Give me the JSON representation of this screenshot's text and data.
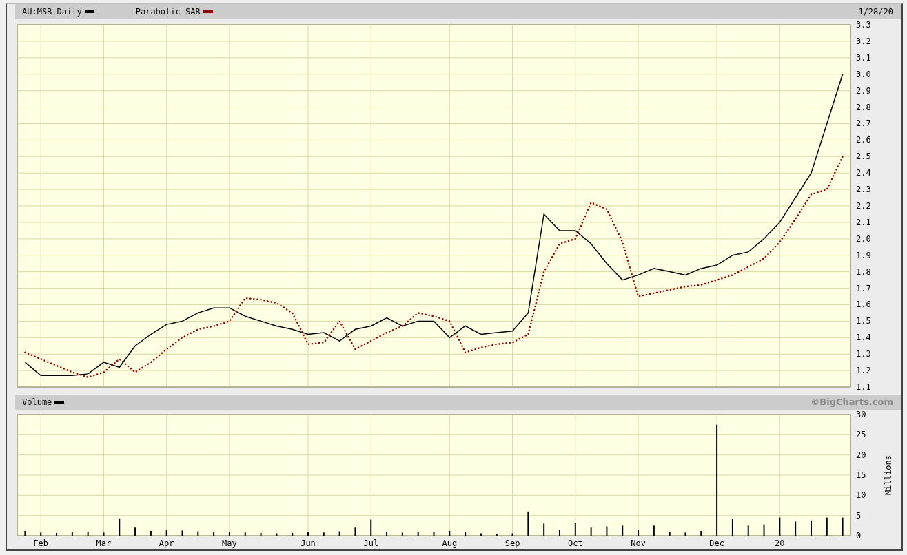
{
  "header": {
    "date": "1/28/20"
  },
  "price_chart": {
    "chart_data": {
      "type": "line",
      "grid": true,
      "categories": [
        null,
        null,
        null,
        null,
        null,
        null,
        null,
        null,
        null,
        null,
        null,
        null,
        null,
        null,
        null,
        null,
        null,
        null,
        null,
        null,
        null,
        null,
        null,
        null,
        null,
        null,
        null,
        null,
        null,
        null,
        null,
        null,
        null,
        null,
        null,
        null,
        null,
        null,
        null,
        null,
        null,
        null,
        null,
        null,
        null,
        null,
        null,
        null,
        null,
        null,
        null,
        null,
        null
      ],
      "series": [
        {
          "name": "AU:MSB Daily",
          "color": "#000000",
          "values": [
            1.25,
            1.17,
            1.17,
            1.17,
            1.18,
            1.25,
            1.22,
            1.35,
            1.42,
            1.48,
            1.5,
            1.55,
            1.58,
            1.58,
            1.53,
            1.5,
            1.47,
            1.45,
            1.42,
            1.43,
            1.38,
            1.45,
            1.47,
            1.52,
            1.47,
            1.5,
            1.5,
            1.4,
            1.47,
            1.42,
            1.43,
            1.44,
            1.55,
            2.15,
            2.05,
            2.05,
            1.97,
            1.85,
            1.75,
            1.78,
            1.82,
            1.8,
            1.78,
            1.82,
            1.84,
            1.9,
            1.92,
            2.0,
            2.1,
            2.25,
            2.4,
            2.7,
            3.0
          ]
        },
        {
          "name": "Parabolic SAR",
          "line_style": "dotted",
          "color": "#990000",
          "values": [
            1.31,
            1.27,
            1.23,
            1.19,
            1.16,
            1.19,
            1.27,
            1.19,
            1.25,
            1.33,
            1.4,
            1.45,
            1.47,
            1.5,
            1.64,
            1.63,
            1.61,
            1.55,
            1.36,
            1.37,
            1.5,
            1.33,
            1.38,
            1.43,
            1.47,
            1.55,
            1.53,
            1.5,
            1.31,
            1.34,
            1.36,
            1.37,
            1.42,
            1.8,
            1.97,
            2.0,
            2.22,
            2.18,
            1.98,
            1.65,
            1.67,
            1.69,
            1.71,
            1.72,
            1.75,
            1.78,
            1.83,
            1.88,
            1.98,
            2.12,
            2.27,
            2.3,
            2.5
          ]
        }
      ],
      "ylim": [
        1.1,
        3.3
      ],
      "yticks": [
        {
          "value": 1.1,
          "label": "1.1"
        },
        {
          "value": 1.2,
          "label": "1.2"
        },
        {
          "value": 1.3,
          "label": "1.3"
        },
        {
          "value": 1.4,
          "label": "1.4"
        },
        {
          "value": 1.5,
          "label": "1.5"
        },
        {
          "value": 1.6,
          "label": "1.6"
        },
        {
          "value": 1.7,
          "label": "1.7"
        },
        {
          "value": 1.8,
          "label": "1.8"
        },
        {
          "value": 1.9,
          "label": "1.9"
        },
        {
          "value": 2.0,
          "label": "2.0"
        },
        {
          "value": 2.1,
          "label": "2.1"
        },
        {
          "value": 2.2,
          "label": "2.2"
        },
        {
          "value": 2.3,
          "label": "2.3"
        },
        {
          "value": 2.4,
          "label": "2.4"
        },
        {
          "value": 2.5,
          "label": "2.5"
        },
        {
          "value": 2.6,
          "label": "2.6"
        },
        {
          "value": 2.7,
          "label": "2.7"
        },
        {
          "value": 2.8,
          "label": "2.8"
        },
        {
          "value": 2.9,
          "label": "2.9"
        },
        {
          "value": 3.0,
          "label": "3.0"
        },
        {
          "value": 3.1,
          "label": "3.1"
        },
        {
          "value": 3.2,
          "label": "3.2"
        },
        {
          "value": 3.3,
          "label": "3.3"
        }
      ]
    }
  },
  "volume_chart": {
    "credit": "©BigCharts.com",
    "chart_data": {
      "type": "bar",
      "grid": true,
      "ylabel": "Millions",
      "categories": [
        null,
        "Feb",
        null,
        null,
        null,
        "Mar",
        null,
        null,
        null,
        "Apr",
        null,
        null,
        null,
        "May",
        null,
        null,
        null,
        null,
        "Jun",
        null,
        null,
        null,
        "Jul",
        null,
        null,
        null,
        null,
        "Aug",
        null,
        null,
        null,
        "Sep",
        null,
        null,
        null,
        "Oct",
        null,
        null,
        null,
        "Nov",
        null,
        null,
        null,
        null,
        "Dec",
        null,
        null,
        null,
        "20",
        null,
        null,
        null,
        null
      ],
      "series": [
        {
          "name": "Volume",
          "color": "#000000",
          "values": [
            1.2,
            0.8,
            0.7,
            0.9,
            1.0,
            0.8,
            4.3,
            2.0,
            1.2,
            1.5,
            1.3,
            1.1,
            0.9,
            1.0,
            0.8,
            0.7,
            0.6,
            0.7,
            0.9,
            0.8,
            1.1,
            2.0,
            4.0,
            1.0,
            0.8,
            0.9,
            1.0,
            1.2,
            0.9,
            0.6,
            0.5,
            0.6,
            6.0,
            3.0,
            1.5,
            3.2,
            2.0,
            2.3,
            2.5,
            1.5,
            2.5,
            1.0,
            0.8,
            1.2,
            27.5,
            4.2,
            2.5,
            2.8,
            4.5,
            3.5,
            3.8,
            4.5,
            4.5
          ]
        }
      ],
      "ylim": [
        0,
        30
      ],
      "yticks": [
        {
          "value": 0,
          "label": "0"
        },
        {
          "value": 5,
          "label": "5"
        },
        {
          "value": 10,
          "label": "10"
        },
        {
          "value": 15,
          "label": "15"
        },
        {
          "value": 20,
          "label": "20"
        },
        {
          "value": 25,
          "label": "25"
        },
        {
          "value": 30,
          "label": "30"
        }
      ]
    }
  }
}
